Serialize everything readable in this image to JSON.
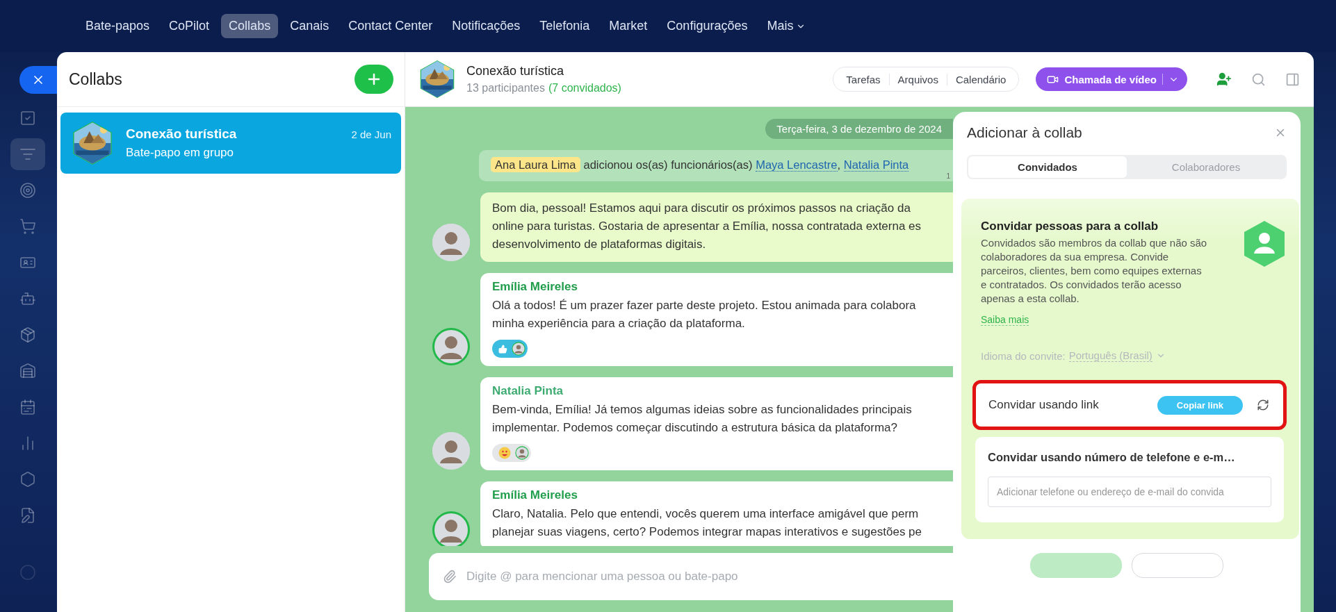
{
  "nav": {
    "items": [
      {
        "label": "Bate-papos",
        "selected": false,
        "dropdown": false
      },
      {
        "label": "CoPilot",
        "selected": false,
        "dropdown": false
      },
      {
        "label": "Collabs",
        "selected": true,
        "dropdown": false
      },
      {
        "label": "Canais",
        "selected": false,
        "dropdown": false
      },
      {
        "label": "Contact Center",
        "selected": false,
        "dropdown": false
      },
      {
        "label": "Notificações",
        "selected": false,
        "dropdown": false
      },
      {
        "label": "Telefonia",
        "selected": false,
        "dropdown": false
      },
      {
        "label": "Market",
        "selected": false,
        "dropdown": false
      },
      {
        "label": "Configurações",
        "selected": false,
        "dropdown": false
      },
      {
        "label": "Mais",
        "selected": false,
        "dropdown": true
      }
    ]
  },
  "rail": {
    "items": [
      {
        "kind": "tasks",
        "selected": false
      },
      {
        "kind": "funnel",
        "selected": true
      },
      {
        "kind": "target",
        "selected": false
      },
      {
        "kind": "cart",
        "selected": false
      },
      {
        "kind": "card",
        "selected": false
      },
      {
        "kind": "bot",
        "selected": false
      },
      {
        "kind": "package",
        "selected": false
      },
      {
        "kind": "warehouse",
        "selected": false
      },
      {
        "kind": "calendar",
        "selected": false
      },
      {
        "kind": "chart",
        "selected": false
      },
      {
        "kind": "hexagon",
        "selected": false
      },
      {
        "kind": "document",
        "selected": false
      },
      {
        "kind": "circle",
        "selected": false
      }
    ]
  },
  "list": {
    "title": "Collabs",
    "items": [
      {
        "title": "Conexão turística",
        "subtitle": "Bate-papo em grupo",
        "date": "2 de Jun",
        "selected": true
      }
    ]
  },
  "chat": {
    "title": "Conexão turística",
    "participants": "13 participantes",
    "guests": "(7 convidados)",
    "tools": [
      "Tarefas",
      "Arquivos",
      "Calendário"
    ],
    "video_button": "Chamada de vídeo",
    "date": "Terça-feira, 3 de dezembro de 2024",
    "system_message": {
      "actor": "Ana Laura Lima",
      "text": "adicionou os(as) funcionários(as)",
      "links": [
        "Maya Lencastre",
        "Natalia Pinta"
      ],
      "separator": ",",
      "time": "1"
    },
    "messages": [
      {
        "kind": "intro",
        "guest": false,
        "lines": [
          "Bom dia, pessoal! Estamos aqui para discutir os próximos passos na criação da",
          "online para turistas. Gostaria de apresentar a Emília, nossa contratada externa es",
          "desenvolvimento de plataformas digitais."
        ]
      },
      {
        "kind": "text",
        "author": "Emília Meireles",
        "guest": true,
        "lines": [
          "Olá a todos! É um prazer fazer parte deste projeto. Estou animada para colabora",
          "minha experiência para a criação da plataforma."
        ],
        "reactions": [
          {
            "kind": "like",
            "selected": true
          }
        ]
      },
      {
        "kind": "text",
        "author": "Natalia Pinta",
        "guest": false,
        "lines": [
          "Bem-vinda, Emília! Já temos algumas ideias sobre as funcionalidades principais",
          "implementar. Podemos começar discutindo a estrutura básica da plataforma?"
        ],
        "reactions": [
          {
            "kind": "love",
            "selected": false
          }
        ]
      },
      {
        "kind": "text",
        "author": "Emília Meireles",
        "guest": true,
        "lines": [
          "Claro, Natalia. Pelo que entendi, vocês querem uma interface amigável que perm",
          "planejar suas viagens, certo? Podemos integrar mapas interativos e sugestões pe"
        ]
      }
    ],
    "composer": {
      "placeholder": "Digite @ para mencionar uma pessoa ou bate-papo"
    }
  },
  "panel": {
    "title": "Adicionar à collab",
    "tabs": [
      {
        "label": "Convidados",
        "selected": true
      },
      {
        "label": "Colaboradores",
        "selected": false
      }
    ],
    "invite": {
      "title": "Convidar pessoas para a collab",
      "description": "Convidados são membros da collab que não são colaboradores da sua empresa. Convide parceiros, clientes, bem como equipes externas e contratados. Os convidados terão acesso apenas a esta collab.",
      "link": "Saiba mais",
      "language_label": "Idioma do convite:",
      "language": "Português (Brasil)",
      "disabled": true
    },
    "link_invite": {
      "title": "Convidar usando link",
      "button": "Copiar link",
      "highlighted": true
    },
    "contact_invite": {
      "title": "Convidar usando número de telefone e e-m…",
      "placeholder": "Adicionar telefone ou endereço de e-mail do convida"
    }
  }
}
